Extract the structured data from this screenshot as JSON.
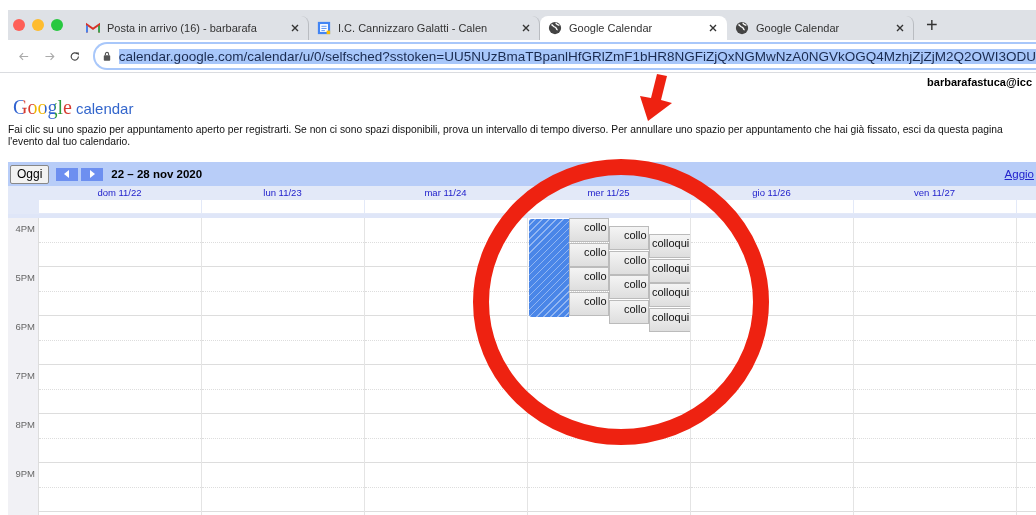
{
  "browser": {
    "tabs": [
      {
        "title": "Posta in arrivo (16) - barbarafa",
        "selected": false
      },
      {
        "title": "I.C. Cannizzaro Galatti - Calen",
        "selected": false
      },
      {
        "title": "Google Calendar",
        "selected": true
      },
      {
        "title": "Google Calendar",
        "selected": false
      }
    ],
    "new_tab": "+",
    "url": "calendar.google.com/calendar/u/0/selfsched?sstoken=UU5NUzBmaTBpanlHfGRlZmF1bHR8NGFiZjQxNGMwNzA0NGVkOGQ4MzhjZjZjM2Q2OWI3ODU"
  },
  "page": {
    "account": "barbarafastuca@icc",
    "logo": {
      "brand": "Google",
      "product": "calendar"
    },
    "instructions": [
      "Fai clic su uno spazio per appuntamento aperto per registrarti. Se non ci sono spazi disponibili, prova un intervallo di tempo diverso. Per annullare uno spazio per appuntamento che hai già fissato, esci da questa pagina",
      "l'evento dal tuo calendario."
    ],
    "toolbar": {
      "today": "Oggi",
      "range": "22 – 28 nov 2020",
      "refresh_link": "Aggio"
    },
    "days": [
      {
        "label": "dom 11/22"
      },
      {
        "label": "lun 11/23"
      },
      {
        "label": "mar 11/24"
      },
      {
        "label": "mer 11/25",
        "slot_groups": [
          [
            "collo",
            "collo",
            "collo",
            "collo"
          ],
          [
            "collo",
            "collo",
            "collo",
            "collo"
          ],
          [
            "colloqui",
            "colloqui",
            "colloqui",
            "colloqui"
          ]
        ]
      },
      {
        "label": "gio 11/26"
      },
      {
        "label": "ven 11/27"
      }
    ],
    "hours": [
      "4PM",
      "5PM",
      "6PM",
      "7PM",
      "8PM",
      "9PM"
    ]
  }
}
